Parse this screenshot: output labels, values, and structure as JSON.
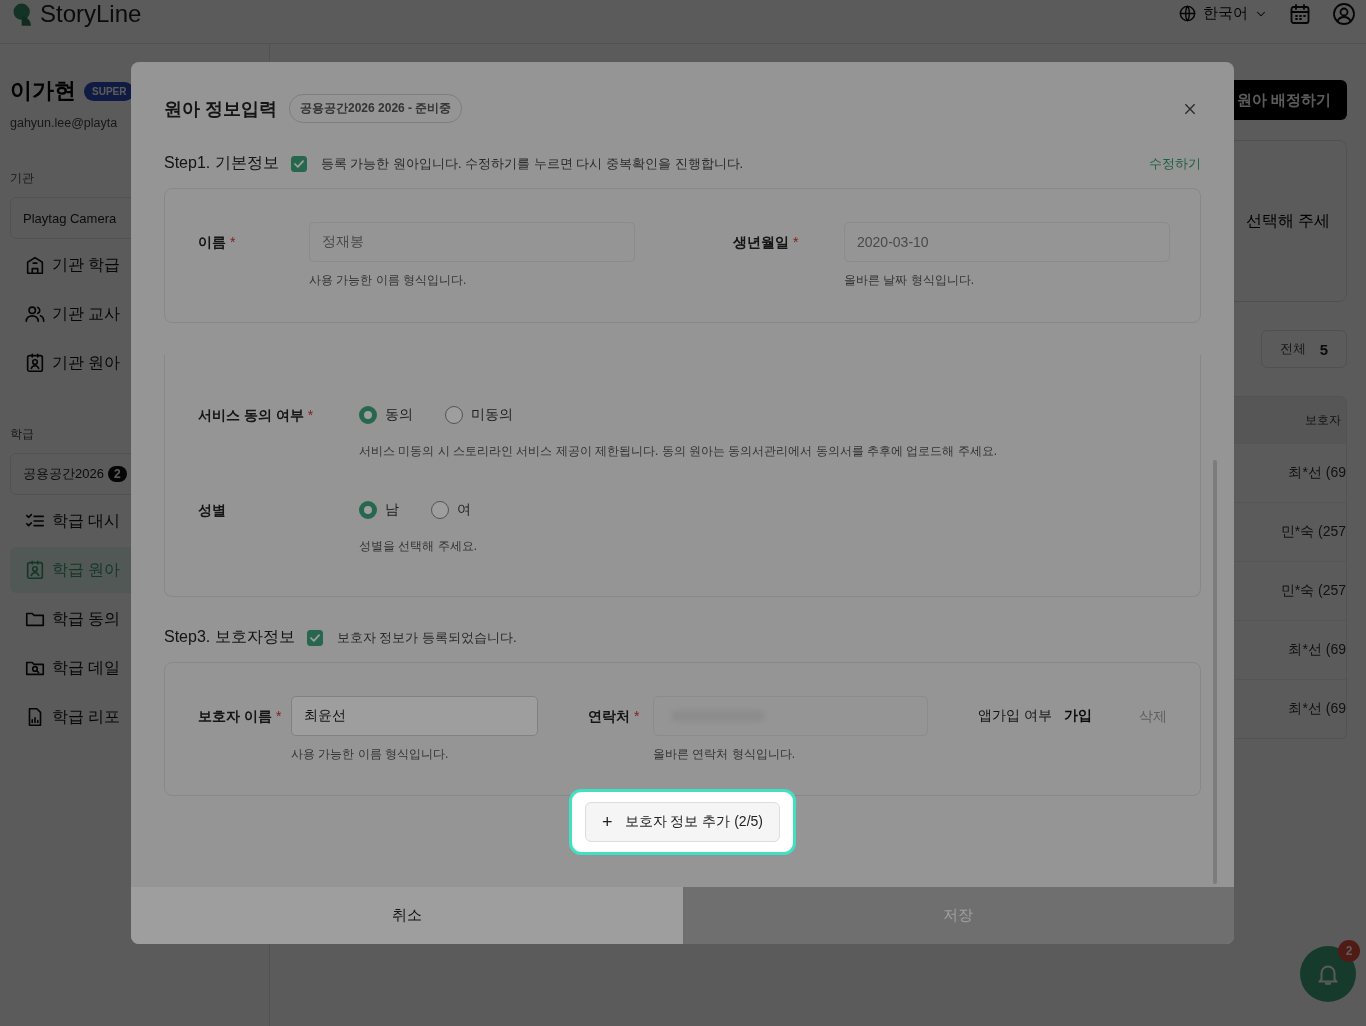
{
  "header": {
    "logo": "StoryLine",
    "language": "한국어"
  },
  "sidebar": {
    "user_name": "이가현",
    "role_badge": "SUPER",
    "email": "gahyun.lee@playta",
    "org_label": "기관",
    "org_select": "Playtag Camera",
    "org_items": [
      {
        "label": "기관 학급",
        "selected": false
      },
      {
        "label": "기관 교사",
        "selected": false
      },
      {
        "label": "기관 원아",
        "selected": false
      }
    ],
    "class_label": "학급",
    "class_select": "공용공간2026",
    "class_badge": "2",
    "class_items": [
      {
        "label": "학급 대시",
        "selected": false
      },
      {
        "label": "학급 원아",
        "selected": true
      },
      {
        "label": "학급 동의",
        "selected": false
      },
      {
        "label": "학급 데일",
        "selected": false
      },
      {
        "label": "학급 리포",
        "selected": false
      }
    ]
  },
  "main": {
    "assign_button": "원아 배정하기",
    "hint": "선택해 주세",
    "total_label": "전체",
    "total_count": "5",
    "table": {
      "columns": [
        "보호자"
      ],
      "rows": [
        "최*선 (69",
        "민*숙 (257",
        "민*숙 (257",
        "최*선 (69",
        "최*선 (69"
      ]
    }
  },
  "notifications": {
    "count": "2"
  },
  "modal": {
    "title": "원아 정보입력",
    "badge": "공용공간2026 2026 - 준비중",
    "step1": {
      "title": "Step1. 기본정보",
      "checked": true,
      "message": "등록 가능한 원아입니다. 수정하기를 누르면 다시 중복확인을 진행합니다.",
      "edit_link": "수정하기",
      "fields": [
        {
          "label": "이름",
          "required_mark": "*",
          "value": "정재봉",
          "disabled": true,
          "help": "사용 가능한 이름 형식입니다."
        },
        {
          "label": "생년월일",
          "required_mark": "*",
          "value": "2020-03-10",
          "disabled": true,
          "help": "올바른 날짜 형식입니다."
        }
      ]
    },
    "step2": {
      "groups": [
        {
          "label": "서비스 동의 여부",
          "required_mark": "*",
          "options": [
            {
              "label": "동의",
              "selected": true
            },
            {
              "label": "미동의",
              "selected": false
            }
          ],
          "help": "서비스 미동의 시 스토리라인 서비스 제공이 제한됩니다. 동의 원아는 동의서관리에서 동의서를 추후에 업로드해 주세요."
        },
        {
          "label": "성별",
          "options": [
            {
              "label": "남",
              "selected": true
            },
            {
              "label": "여",
              "selected": false
            }
          ],
          "help": "성별을 선택해 주세요."
        }
      ]
    },
    "step3": {
      "title": "Step3. 보호자정보",
      "checked": true,
      "message": "보호자 정보가 등록되었습니다.",
      "guardians": [
        {
          "name_label": "보호자 이름",
          "name_required_mark": "*",
          "name_value": "최윤선",
          "name_disabled": false,
          "name_help": "사용 가능한 이름 형식입니다.",
          "phone_label": "연락처",
          "phone_required_mark": "*",
          "phone_disabled": true,
          "phone_help": "올바른 연락처 형식입니다.",
          "app_label": "앱가입 여부",
          "app_value": "가입",
          "delete_label": "삭제"
        }
      ],
      "add_button": {
        "icon": "+",
        "label": "보호자 정보 추가 (2/5)",
        "highlighted": true
      }
    },
    "footer": {
      "cancel": "취소",
      "save": {
        "label": "저장",
        "disabled": true
      }
    }
  }
}
